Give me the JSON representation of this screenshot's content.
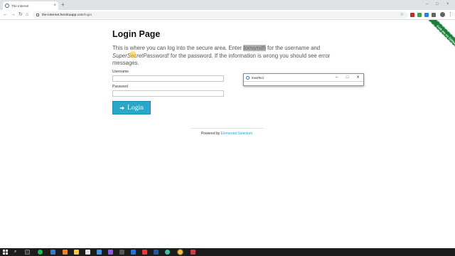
{
  "browser": {
    "tab_title": "The Internet",
    "tab_close_glyph": "×",
    "new_tab_glyph": "+",
    "url_host": "the-internet.herokuapp.com",
    "url_path": "/login",
    "minimize_glyph": "–",
    "maximize_glyph": "□",
    "close_glyph": "×",
    "back_glyph": "←",
    "forward_glyph": "→",
    "reload_glyph": "↻",
    "home_glyph": "⌂",
    "star_glyph": "☆",
    "menu_glyph": "⋮"
  },
  "page": {
    "ribbon_text": "Fork me on GitHub",
    "title": "Login Page",
    "intro_part1": "This is where you can log into the secure area. Enter ",
    "username_hint": "tomsmith",
    "intro_part2": " for the username and ",
    "password_hint": "SuperSecretPassword!",
    "intro_part3": " for the password. If the information is wrong you should see error messages.",
    "username_label": "Username",
    "password_label": "Password",
    "login_button": "Login",
    "footer_prefix": "Powered by ",
    "footer_link": "Elemental Selenium"
  },
  "floating_window": {
    "title": "InsetTect",
    "minimize_glyph": "–",
    "maximize_glyph": "□",
    "close_glyph": "✕"
  },
  "taskbar": {
    "search_glyph": "⌕"
  },
  "colors": {
    "accent": "#2ba6cb",
    "ribbon": "#1a7f3c",
    "taskbar": "#1c1c1c"
  }
}
